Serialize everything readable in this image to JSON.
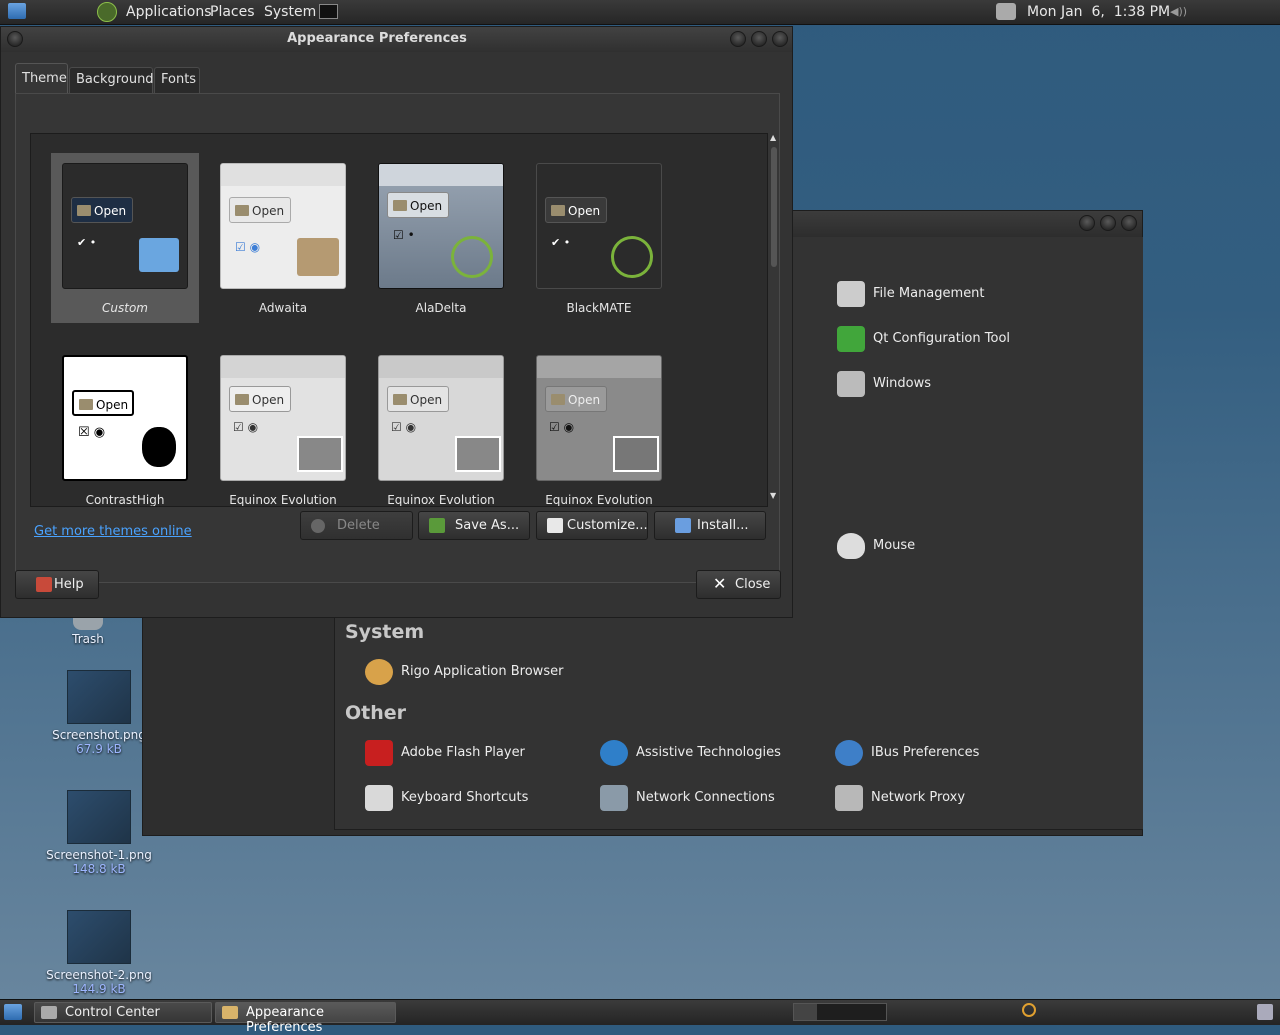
{
  "top_panel": {
    "menus": [
      "Applications",
      "Places",
      "System"
    ],
    "clock": "Mon Jan  6,  1:38 PM"
  },
  "desktop": {
    "icons": [
      {
        "label": "Trash",
        "size": ""
      },
      {
        "label": "Screenshot.png",
        "size": "67.9 kB"
      },
      {
        "label": "Screenshot-1.png",
        "size": "148.8 kB"
      },
      {
        "label": "Screenshot-2.png",
        "size": "144.9 kB"
      }
    ]
  },
  "control_center": {
    "personal_items": [
      "File Management",
      "Qt Configuration Tool",
      "Windows"
    ],
    "hardware_items": [
      "Mouse"
    ],
    "sections": {
      "system": "System",
      "other": "Other"
    },
    "system_items": [
      "Rigo Application Browser"
    ],
    "other_items": [
      "Adobe Flash Player",
      "Assistive Technologies",
      "IBus Preferences",
      "Keyboard Shortcuts",
      "Network Connections",
      "Network Proxy"
    ]
  },
  "appearance": {
    "title": "Appearance Preferences",
    "tabs": [
      "Theme",
      "Background",
      "Fonts"
    ],
    "active_tab": "Theme",
    "themes": [
      {
        "name": "Custom",
        "selected": true
      },
      {
        "name": "Adwaita",
        "selected": false
      },
      {
        "name": "AlaDelta",
        "selected": false
      },
      {
        "name": "BlackMATE",
        "selected": false
      },
      {
        "name": "ContrastHigh",
        "selected": false
      },
      {
        "name": "Equinox Evolution",
        "selected": false
      },
      {
        "name": "Equinox Evolution",
        "selected": false
      },
      {
        "name": "Equinox Evolution",
        "selected": false
      }
    ],
    "preview_button": "Open",
    "buttons": {
      "delete": "Delete",
      "save_as": "Save As...",
      "customize": "Customize...",
      "install": "Install..."
    },
    "get_more_link": "Get more themes online",
    "help": "Help",
    "close": "Close"
  },
  "taskbar": {
    "tasks": [
      "Control Center",
      "Appearance Preferences"
    ],
    "active_task": "Appearance Preferences"
  },
  "colors": {
    "accent_link": "#4aa3ff",
    "selection": "#595959"
  }
}
